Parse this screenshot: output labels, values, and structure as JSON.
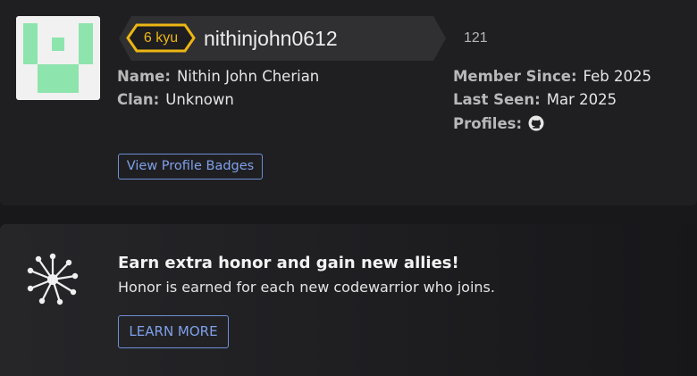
{
  "profile": {
    "rank": "6 kyu",
    "username": "nithinjohn0612",
    "honor": "121",
    "name_label": "Name:",
    "name_value": "Nithin John Cherian",
    "clan_label": "Clan:",
    "clan_value": "Unknown",
    "member_since_label": "Member Since:",
    "member_since_value": "Feb 2025",
    "last_seen_label": "Last Seen:",
    "last_seen_value": "Mar 2025",
    "profiles_label": "Profiles:",
    "profile_links": [
      "github-icon"
    ],
    "badges_button": "View Profile Badges",
    "avatar_icon": "identicon-avatar",
    "colors": {
      "rank": "#ecb613",
      "identicon": "#8ee4ad",
      "link": "#7fa0e8"
    }
  },
  "promo": {
    "icon": "allies-network-icon",
    "title": "Earn extra honor and gain new allies!",
    "text": "Honor is earned for each new codewarrior who joins.",
    "button": "LEARN MORE"
  }
}
